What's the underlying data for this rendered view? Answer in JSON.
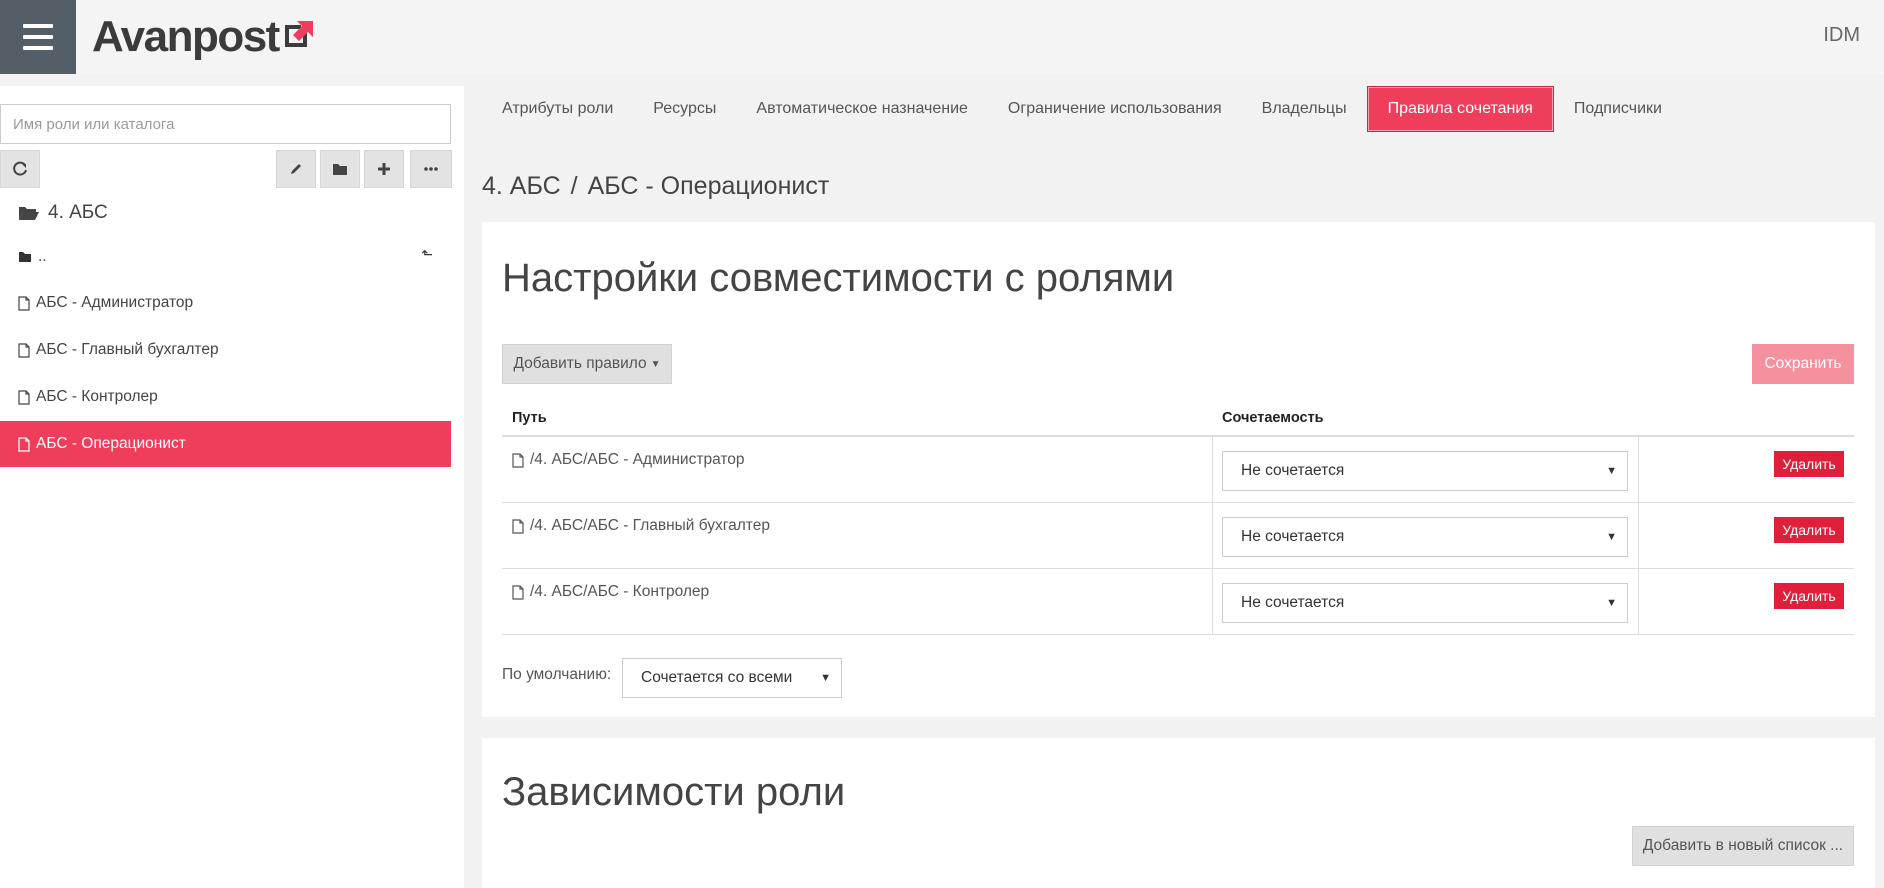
{
  "header": {
    "logo": "Avanpost",
    "app": "IDM"
  },
  "sidebar": {
    "search_placeholder": "Имя роли или каталога",
    "folder": "4. АБС",
    "up_item": "..",
    "items": [
      {
        "label": "АБС - Администратор",
        "active": false
      },
      {
        "label": "АБС - Главный бухгалтер",
        "active": false
      },
      {
        "label": "АБС - Контролер",
        "active": false
      },
      {
        "label": "АБС - Операционист",
        "active": true
      }
    ]
  },
  "tabs": [
    {
      "label": "Атрибуты роли"
    },
    {
      "label": "Ресурсы"
    },
    {
      "label": "Автоматическое назначение"
    },
    {
      "label": "Ограничение использования"
    },
    {
      "label": "Владельцы"
    },
    {
      "label": "Правила сочетания",
      "active": true
    },
    {
      "label": "Подписчики"
    }
  ],
  "breadcrumb": {
    "parent": "4. АБС",
    "sep": "/",
    "current": "АБС - Операционист"
  },
  "compat": {
    "title": "Настройки совместимости с ролями",
    "add_rule": "Добавить правило",
    "save": "Сохранить",
    "col_path": "Путь",
    "col_compat": "Сочетаемость",
    "rows": [
      {
        "path": "/4. АБС/АБС - Администратор",
        "value": "Не сочетается",
        "delete": "Удалить"
      },
      {
        "path": "/4. АБС/АБС - Главный бухгалтер",
        "value": "Не сочетается",
        "delete": "Удалить"
      },
      {
        "path": "/4. АБС/АБС - Контролер",
        "value": "Не сочетается",
        "delete": "Удалить"
      }
    ],
    "default_label": "По умолчанию:",
    "default_value": "Сочетается со всеми"
  },
  "deps": {
    "title": "Зависимости роли",
    "add_new": "Добавить в новый список ..."
  },
  "colors": {
    "accent": "#ef3e5b",
    "danger": "#e0203b",
    "header_dark": "#545e66"
  }
}
